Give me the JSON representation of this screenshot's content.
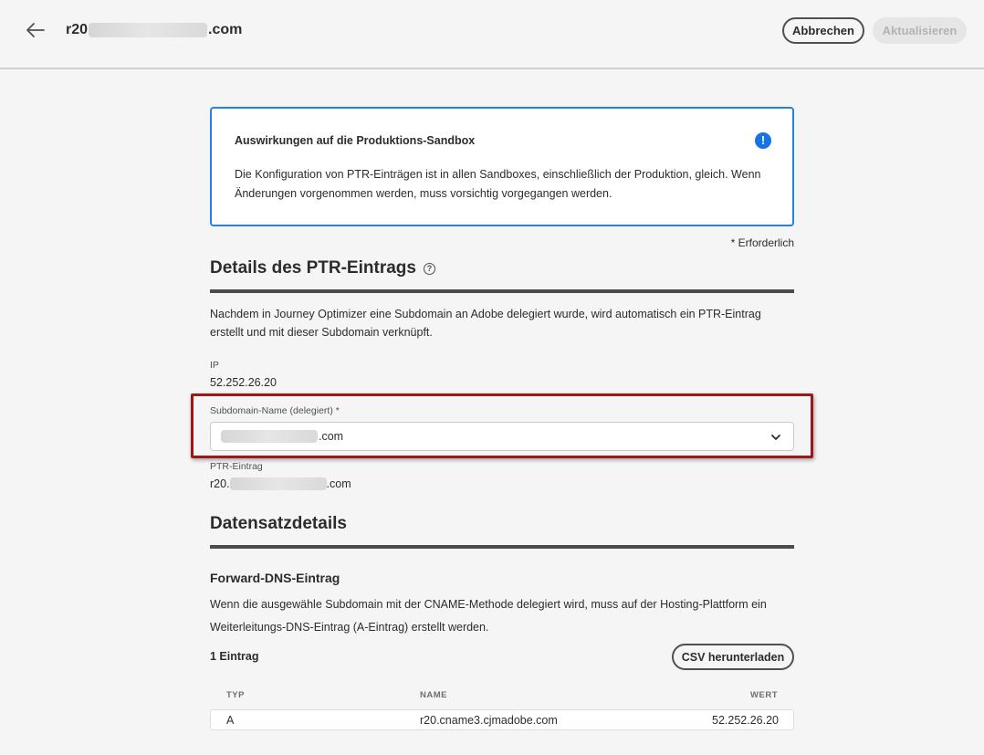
{
  "header": {
    "title_prefix": "r20",
    "title_suffix": ".com",
    "cancel_label": "Abbrechen",
    "update_label": "Aktualisieren"
  },
  "alert": {
    "title": "Auswirkungen auf die Produktions-Sandbox",
    "body": "Die Konfiguration von PTR-Einträgen ist in allen Sandboxes, einschließlich der Produktion, gleich. Wenn Änderungen vorgenommen werden, muss vorsichtig vorgegangen werden.",
    "icon": "alert-info-icon",
    "icon_glyph": "!"
  },
  "required_note": "* Erforderlich",
  "ptr_section": {
    "heading": "Details des PTR-Eintrags",
    "help_glyph": "?",
    "description": "Nachdem in Journey Optimizer eine Subdomain an Adobe delegiert wurde, wird automatisch ein PTR-Eintrag erstellt und mit dieser Subdomain verknüpft.",
    "ip_label": "IP",
    "ip_value": "52.252.26.20",
    "subdomain_label": "Subdomain-Name (delegiert) *",
    "subdomain_value_suffix": ".com",
    "ptr_label": "PTR-Eintrag",
    "ptr_value_prefix": "r20.",
    "ptr_value_suffix": ".com"
  },
  "record_section": {
    "heading": "Datensatzdetails",
    "subheading": "Forward-DNS-Eintrag",
    "description": "Wenn die ausgewähle Subdomain mit der CNAME-Methode delegiert wird, muss auf der Hosting-Plattform ein Weiterleitungs-DNS-Eintrag (A-Eintrag) erstellt werden.",
    "count": "1 Eintrag",
    "csv_button": "CSV herunterladen",
    "columns": [
      "TYP",
      "NAME",
      "WERT"
    ],
    "rows": [
      {
        "type": "A",
        "name": "r20.cname3.cjmadobe.com",
        "value": "52.252.26.20"
      }
    ]
  },
  "colors": {
    "accent_blue": "#2680eb",
    "highlight_red": "#a31616",
    "background": "#f5f5f5"
  }
}
